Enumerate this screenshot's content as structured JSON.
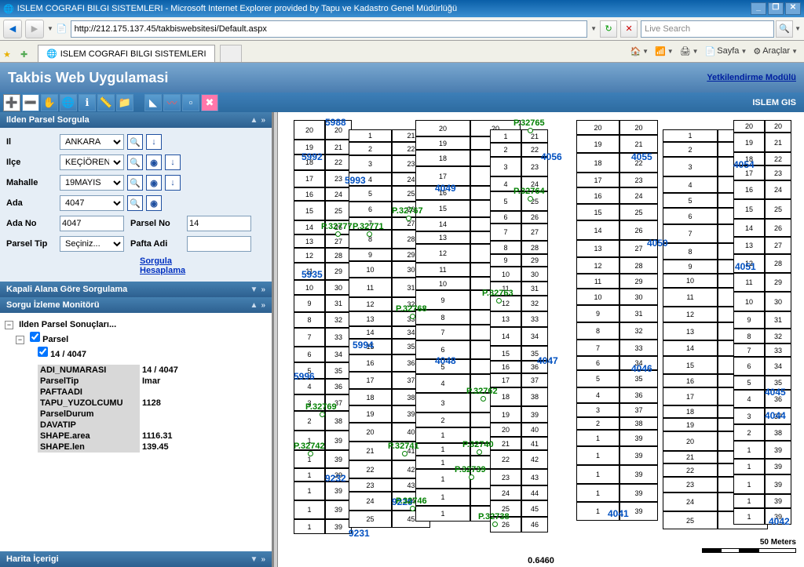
{
  "window": {
    "title": "ISLEM COGRAFI BILGI SISTEMLERI - Microsoft Internet Explorer provided by Tapu ve Kadastro Genel Müdürlüğü"
  },
  "nav": {
    "url": "http://212.175.137.45/takbiswebsitesi/Default.aspx",
    "search_placeholder": "Live Search"
  },
  "tab": {
    "title": "ISLEM COGRAFI BILGI SISTEMLERI"
  },
  "ie_tools": {
    "page": "Sayfa",
    "tools": "Araçlar"
  },
  "header": {
    "title": "Takbis Web Uygulamasi",
    "link": "Yetkilendirme Modülü"
  },
  "brand": "ISLEM GIS",
  "panels": {
    "query": {
      "title": "Ilden Parsel Sorgula",
      "il_label": "Il",
      "il_value": "ANKARA",
      "ilce_label": "Ilçe",
      "ilce_value": "KEÇİÖREN",
      "mahalle_label": "Mahalle",
      "mahalle_value": "19MAYIS",
      "ada_label": "Ada",
      "ada_value": "4047",
      "adano_label": "Ada No",
      "adano_value": "4047",
      "parselno_label": "Parsel No",
      "parselno_value": "14",
      "parseltip_label": "Parsel Tip",
      "parseltip_value": "Seçiniz...",
      "pafta_label": "Pafta Adi",
      "pafta_value": "",
      "link_sorgula": "Sorgula",
      "link_hesaplama": "Hesaplama"
    },
    "kapali": {
      "title": "Kapali Alana Göre Sorgulama"
    },
    "monitor": {
      "title": "Sorgu İzleme Monitörü"
    },
    "harita": {
      "title": "Harita İçerigi"
    }
  },
  "tree": {
    "root": "Ilden Parsel Sonuçları...",
    "parsel": "Parsel",
    "node": "14 / 4047",
    "rows": [
      {
        "k": "ADI_NUMARASI",
        "v": "14 / 4047"
      },
      {
        "k": "ParselTip",
        "v": "Imar"
      },
      {
        "k": "PAFTAADI",
        "v": ""
      },
      {
        "k": "TAPU_YUZOLCUMU",
        "v": "1128"
      },
      {
        "k": "ParselDurum",
        "v": ""
      },
      {
        "k": "DAVATIP",
        "v": ""
      },
      {
        "k": "SHAPE.area",
        "v": "1116.31"
      },
      {
        "k": "SHAPE.len",
        "v": "139.45"
      }
    ]
  },
  "map": {
    "blue_labels": [
      "5988",
      "5992",
      "5993",
      "4049",
      "4056",
      "4055",
      "4054",
      "4050",
      "4051",
      "5935",
      "5994",
      "4048",
      "4047",
      "4046",
      "4045",
      "5996",
      "9232",
      "9229",
      "9231",
      "4041",
      "4042",
      "4044"
    ],
    "green_labels": [
      "P.32765",
      "P.32764",
      "P.32767",
      "P.32777",
      "P.32771",
      "P.32763",
      "P.32768",
      "P.32762",
      "P.32769",
      "P.32742",
      "P.32741",
      "P.32740",
      "P.32739",
      "P.32746",
      "P.32738"
    ],
    "scale_text": "50 Meters",
    "coord_text": "0.6460"
  }
}
